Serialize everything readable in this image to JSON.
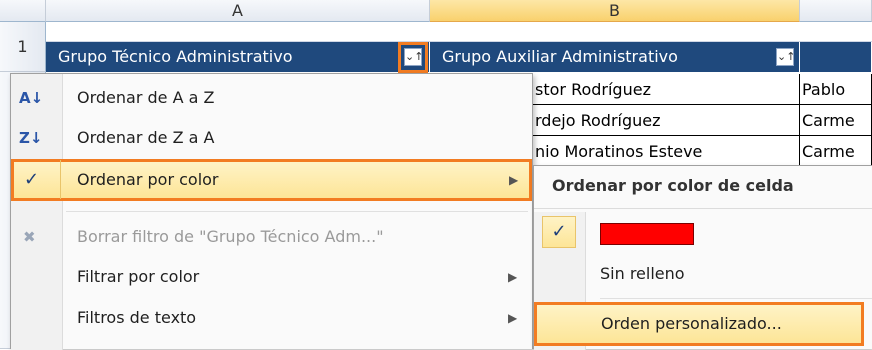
{
  "columns": [
    "A",
    "B"
  ],
  "row_number": "1",
  "header_cells": {
    "a": "Grupo Técnico Administrativo",
    "b": "Grupo Auxiliar Administrativo"
  },
  "filter_button_glyph": "⌄↑",
  "data_rows": [
    {
      "b": "stor Rodríguez",
      "c": "Pablo"
    },
    {
      "b": "rdejo Rodríguez",
      "c": "Carme"
    },
    {
      "b": "nio Moratinos Esteve",
      "c": "Carme"
    }
  ],
  "menu": {
    "items": [
      {
        "label": "Ordenar de A a Z",
        "icon": "sort-az-icon",
        "icon_glyph": "A↓"
      },
      {
        "label": "Ordenar de Z a A",
        "icon": "sort-za-icon",
        "icon_glyph": "Z↓"
      },
      {
        "label": "Ordenar por color",
        "checkmark": "✓",
        "submenu_arrow": "▶"
      },
      {
        "label": "Borrar filtro de \"Grupo Técnico Adm...\"",
        "icon": "clear-filter-icon",
        "icon_glyph": "✖"
      },
      {
        "label": "Filtrar por color",
        "submenu_arrow": "▶"
      },
      {
        "label": "Filtros de texto",
        "submenu_arrow": "▶"
      }
    ]
  },
  "submenu": {
    "header": "Ordenar por color de celda",
    "checkmark": "✓",
    "swatch_color": "#ff0000",
    "no_fill": "Sin relleno",
    "custom": "Orden personalizado..."
  }
}
